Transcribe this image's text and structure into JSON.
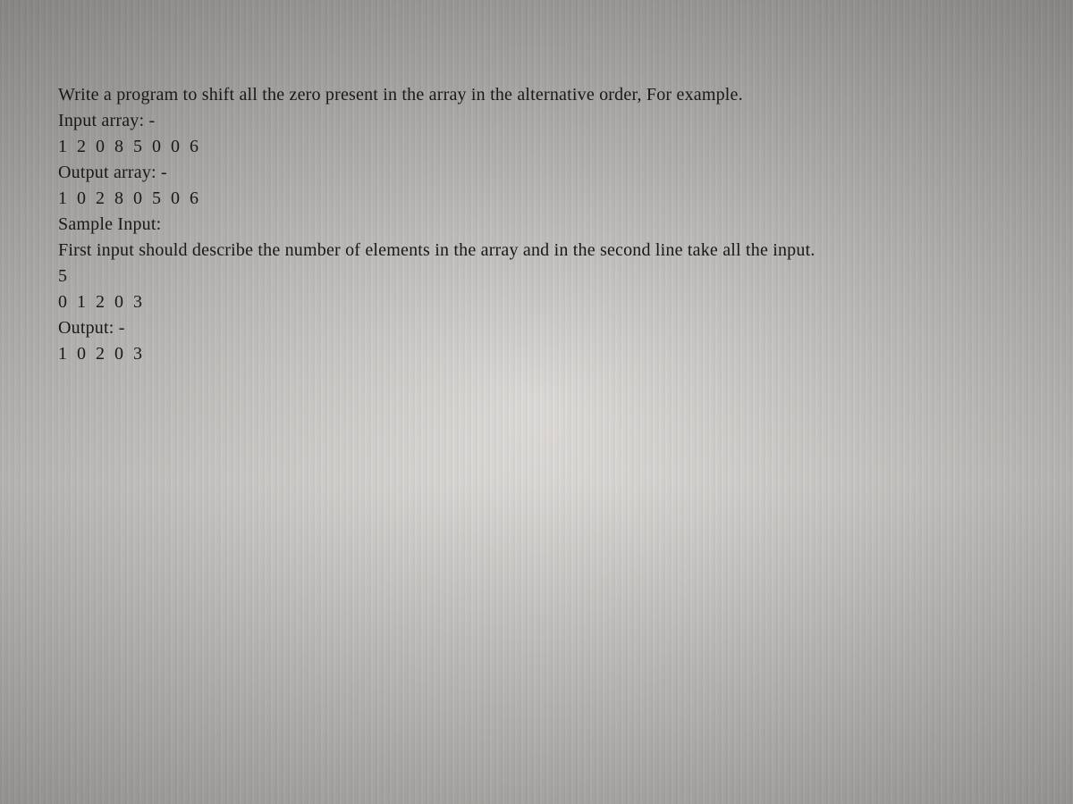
{
  "problem": {
    "description": "Write a program to shift all the zero present in the array in the alternative order, For example.",
    "input_label": "Input array: -",
    "input_example": "1 2 0 8 5 0 0 6",
    "output_label": "Output array: -",
    "output_example": "1 0 2 8 0 5 0 6",
    "sample_input_header": "Sample Input:",
    "sample_input_desc": "First input should describe the number of elements in the array and in the second line take all the input.",
    "sample_n": "5",
    "sample_values": "0 1 2 0 3",
    "sample_output_label": "Output: -",
    "sample_output_values": "1 0 2 0 3"
  }
}
